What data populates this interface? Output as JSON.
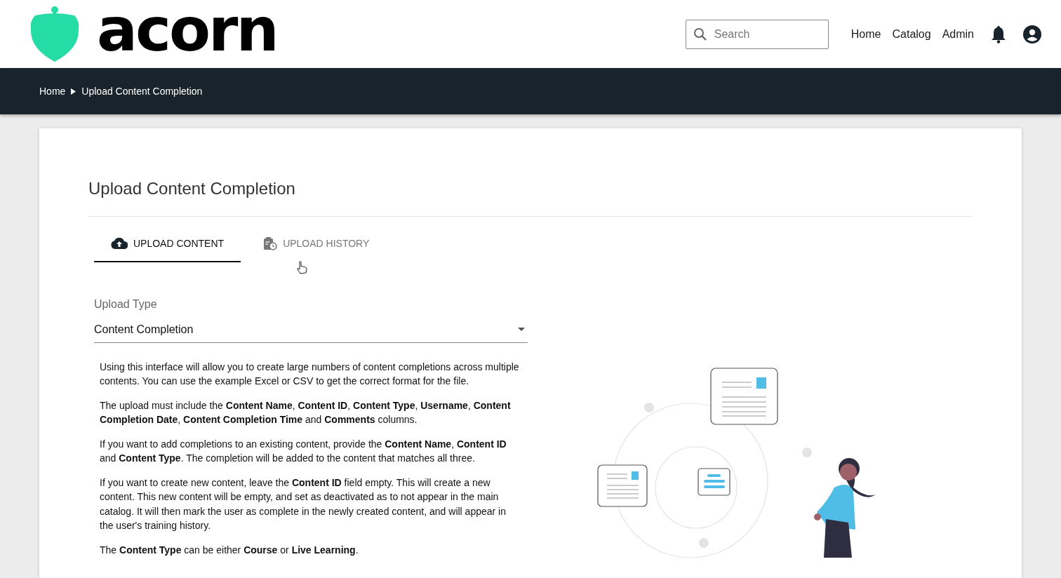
{
  "header": {
    "logo_text": "acorn",
    "search": {
      "placeholder": "Search"
    },
    "nav_links": [
      {
        "label": "Home"
      },
      {
        "label": "Catalog"
      },
      {
        "label": "Admin"
      }
    ]
  },
  "breadcrumb": [
    {
      "label": "Home"
    },
    {
      "label": "Upload Content Completion"
    }
  ],
  "page_title": "Upload Content Completion",
  "tabs": [
    {
      "label": "UPLOAD CONTENT",
      "selected": true,
      "kind": "upload"
    },
    {
      "label": "UPLOAD HISTORY",
      "selected": false,
      "kind": "history"
    }
  ],
  "upload_type": {
    "label": "Upload Type",
    "value": "Content Completion"
  },
  "instructions": [
    "Using this interface will allow you to create large numbers of content completions across multiple contents. You can use the example Excel or CSV to get the correct format for the file.",
    "The upload must include the **Content Name**, **Content ID**, **Content Type**, **Username**, **Content Completion Date**, **Content Completion Time** and **Comments** columns.",
    "If you want to add completions to an existing content, provide the **Content Name**, **Content ID** and **Content Type**. The completion will be added to the content that matches all three.",
    "If you want to create new content, leave the **Content ID** field empty. This will create a new content. This new content will be empty, and set as deactivated as to not appear in the main catalog. It will then mark the user as complete in the newly created content, and will appear in the user's training history.",
    "The **Content Type** can be either **Course** or **Live Learning**."
  ]
}
